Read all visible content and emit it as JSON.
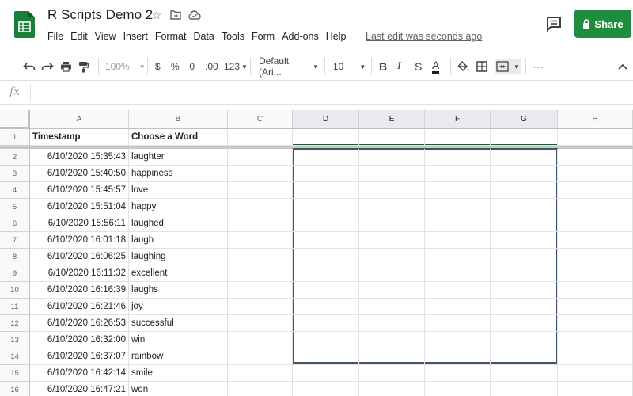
{
  "header": {
    "title": "R Scripts Demo 2",
    "icons": [
      "star-icon",
      "move-to-folder-icon",
      "cloud-status-icon"
    ],
    "menu": [
      "File",
      "Edit",
      "View",
      "Insert",
      "Format",
      "Data",
      "Tools",
      "Form",
      "Add-ons",
      "Help"
    ],
    "last_edit": "Last edit was seconds ago",
    "share_label": "Share",
    "share_color": "#1e8e3e"
  },
  "toolbar": {
    "zoom": "100%",
    "currency": "$",
    "percent": "%",
    "decrease_decimal": ".0",
    "increase_decimal": ".00",
    "more_formats": "123",
    "font": "Default (Ari...",
    "font_size": "10",
    "bold": "B",
    "italic": "I",
    "strike": "S",
    "text_color": "A",
    "more": "⋯"
  },
  "formula_bar": {
    "fx": "fx",
    "value": ""
  },
  "columns": [
    "A",
    "B",
    "C",
    "D",
    "E",
    "F",
    "G",
    "H"
  ],
  "selected_columns": [
    "D",
    "E",
    "F",
    "G"
  ],
  "headers": {
    "A1": "Timestamp",
    "B1": "Choose a Word"
  },
  "rows": [
    {
      "num": "1",
      "timestamp": "Timestamp",
      "word": "Choose a Word"
    },
    {
      "num": "2",
      "timestamp": "6/10/2020 15:35:43",
      "word": "laughter"
    },
    {
      "num": "3",
      "timestamp": "6/10/2020 15:40:50",
      "word": "happiness"
    },
    {
      "num": "4",
      "timestamp": "6/10/2020 15:45:57",
      "word": "love"
    },
    {
      "num": "5",
      "timestamp": "6/10/2020 15:51:04",
      "word": "happy"
    },
    {
      "num": "6",
      "timestamp": "6/10/2020 15:56:11",
      "word": "laughed"
    },
    {
      "num": "7",
      "timestamp": "6/10/2020 16:01:18",
      "word": "laugh"
    },
    {
      "num": "8",
      "timestamp": "6/10/2020 16:06:25",
      "word": "laughing"
    },
    {
      "num": "9",
      "timestamp": "6/10/2020 16:11:32",
      "word": "excellent"
    },
    {
      "num": "10",
      "timestamp": "6/10/2020 16:16:39",
      "word": "laughs"
    },
    {
      "num": "11",
      "timestamp": "6/10/2020 16:21:46",
      "word": "joy"
    },
    {
      "num": "12",
      "timestamp": "6/10/2020 16:26:53",
      "word": "successful"
    },
    {
      "num": "13",
      "timestamp": "6/10/2020 16:32:00",
      "word": "win"
    },
    {
      "num": "14",
      "timestamp": "6/10/2020 16:37:07",
      "word": "rainbow"
    },
    {
      "num": "15",
      "timestamp": "6/10/2020 16:42:14",
      "word": "smile"
    },
    {
      "num": "16",
      "timestamp": "6/10/2020 16:47:21",
      "word": "won"
    }
  ]
}
